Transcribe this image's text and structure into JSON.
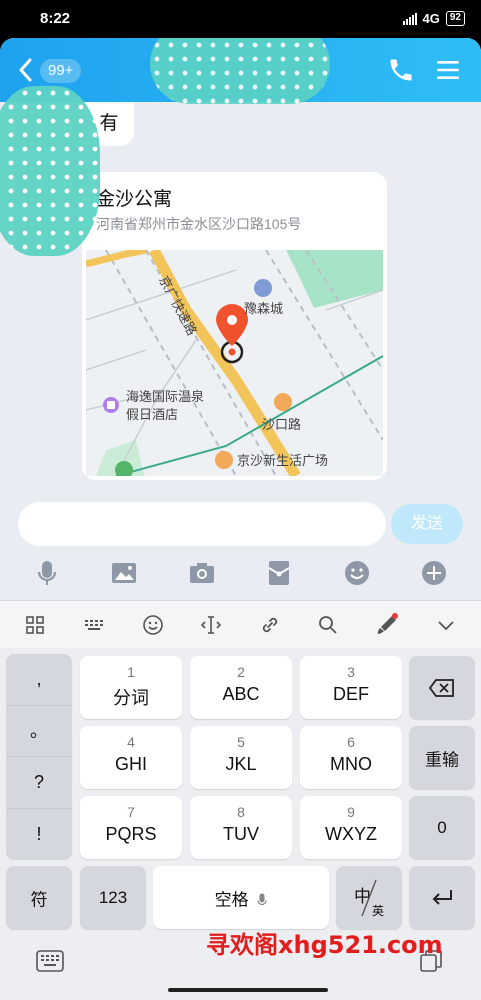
{
  "status_bar": {
    "time": "8:22",
    "network": "4G",
    "battery": "92"
  },
  "header": {
    "unread_badge": "99+"
  },
  "chat": {
    "message_text": "有",
    "location": {
      "name": "金沙公寓",
      "address": "河南省郑州市金水区沙口路105号",
      "map_labels": {
        "expressway": "京广快速路",
        "poi_mall": "豫森城",
        "poi_hotel_line1": "海逸国际温泉",
        "poi_hotel_line2": "假日酒店",
        "road": "沙口路",
        "poi_plaza": "京沙新生活广场"
      }
    }
  },
  "composer": {
    "input_value": "",
    "send_label": "发送"
  },
  "keyboard": {
    "punctuation": [
      ",",
      "。",
      "?",
      "!"
    ],
    "keys": [
      {
        "num": "1",
        "letters": "分词"
      },
      {
        "num": "2",
        "letters": "ABC"
      },
      {
        "num": "3",
        "letters": "DEF"
      },
      {
        "num": "4",
        "letters": "GHI"
      },
      {
        "num": "5",
        "letters": "JKL"
      },
      {
        "num": "6",
        "letters": "MNO"
      },
      {
        "num": "7",
        "letters": "PQRS"
      },
      {
        "num": "8",
        "letters": "TUV"
      },
      {
        "num": "9",
        "letters": "WXYZ"
      }
    ],
    "retype": "重输",
    "zero": "0",
    "symbol": "符",
    "numeric": "123",
    "space": "空格",
    "lang_zh": "中",
    "lang_en": "英"
  },
  "watermark": "寻欢阁xhg521.com",
  "colors": {
    "header": "#1fa2ee",
    "send_disabled": "#bfe8fb",
    "map_pin": "#f0522d",
    "dots": "#5dd3c5"
  }
}
